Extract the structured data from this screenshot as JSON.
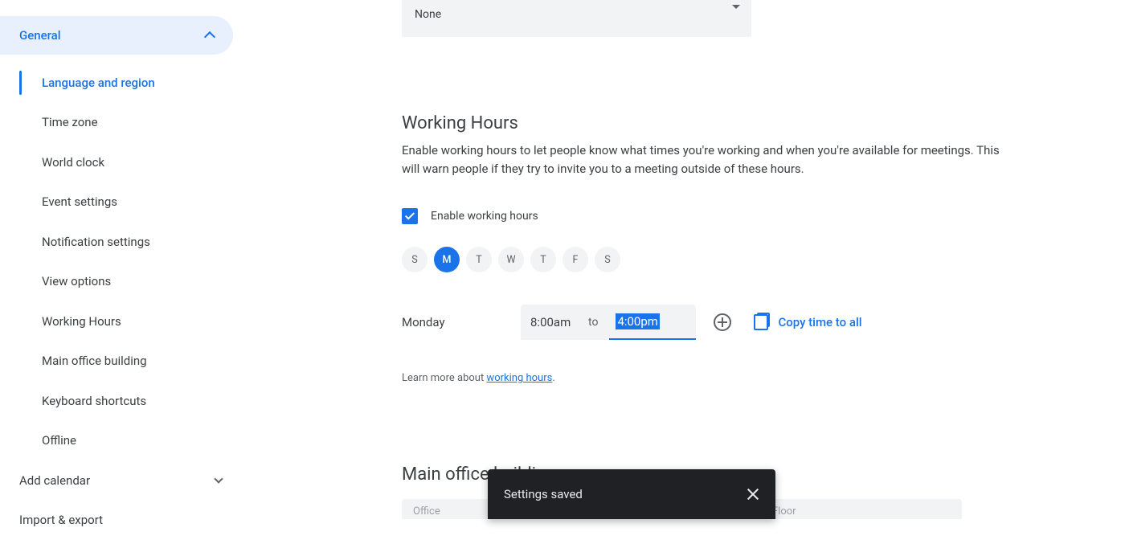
{
  "sidebar": {
    "general": {
      "label": "General"
    },
    "items": [
      {
        "label": "Language and region",
        "active": true
      },
      {
        "label": "Time zone"
      },
      {
        "label": "World clock"
      },
      {
        "label": "Event settings"
      },
      {
        "label": "Notification settings"
      },
      {
        "label": "View options"
      },
      {
        "label": "Working Hours"
      },
      {
        "label": "Main office building"
      },
      {
        "label": "Keyboard shortcuts"
      },
      {
        "label": "Offline"
      }
    ],
    "add_calendar": "Add calendar",
    "import_export": "Import & export"
  },
  "top_dropdown": {
    "value": "None"
  },
  "working_hours": {
    "title": "Working Hours",
    "desc": "Enable working hours to let people know what times you're working and when you're available for meetings. This will warn people if they try to invite you to a meeting outside of these hours.",
    "enable_label": "Enable working hours",
    "enabled": true,
    "days": [
      {
        "short": "S",
        "selected": false
      },
      {
        "short": "M",
        "selected": true
      },
      {
        "short": "T",
        "selected": false
      },
      {
        "short": "W",
        "selected": false
      },
      {
        "short": "T",
        "selected": false
      },
      {
        "short": "F",
        "selected": false
      },
      {
        "short": "S",
        "selected": false
      }
    ],
    "day_label": "Monday",
    "start_time": "8:00am",
    "to_label": "to",
    "end_time": "4:00pm",
    "copy_label": "Copy time to all",
    "learn_prefix": "Learn more about ",
    "learn_link": "working hours",
    "learn_suffix": "."
  },
  "main_office": {
    "title": "Main office building",
    "office_label": "Office",
    "office_value": "—",
    "floor_label": "Floor",
    "floor_value": ""
  },
  "toast": {
    "message": "Settings saved"
  }
}
